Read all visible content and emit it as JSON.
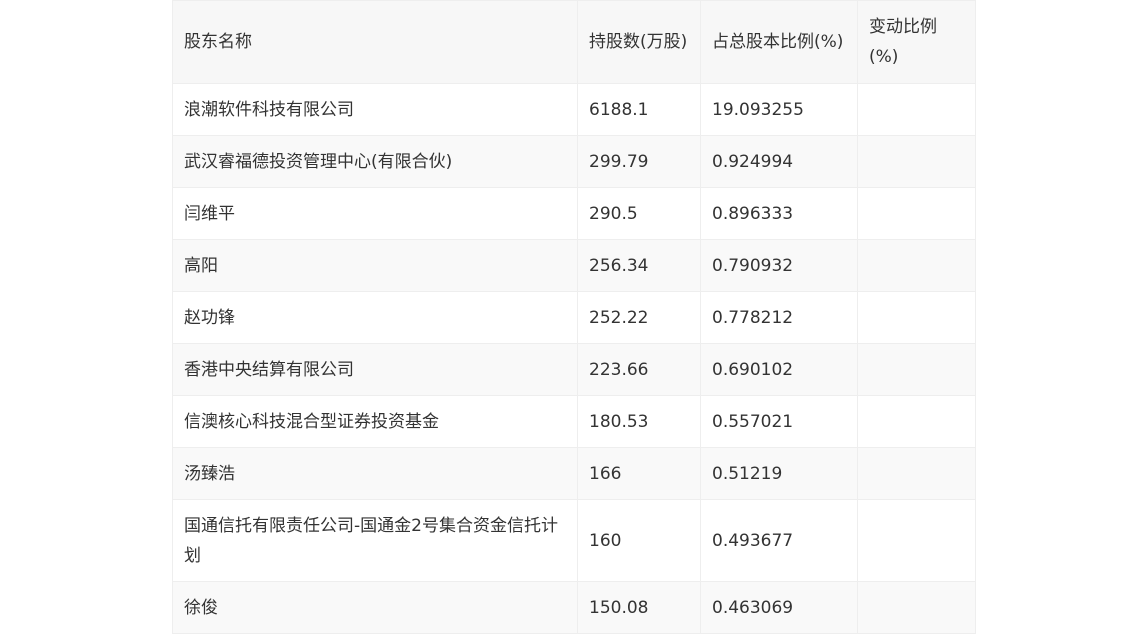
{
  "table": {
    "headers": [
      "股东名称",
      "持股数(万股)",
      "占总股本比例(%)",
      "变动比例(%)"
    ],
    "rows": [
      [
        "浪潮软件科技有限公司",
        "6188.1",
        "19.093255",
        ""
      ],
      [
        "武汉睿福德投资管理中心(有限合伙)",
        "299.79",
        "0.924994",
        ""
      ],
      [
        "闫维平",
        "290.5",
        "0.896333",
        ""
      ],
      [
        "高阳",
        "256.34",
        "0.790932",
        ""
      ],
      [
        "赵功锋",
        "252.22",
        "0.778212",
        ""
      ],
      [
        "香港中央结算有限公司",
        "223.66",
        "0.690102",
        ""
      ],
      [
        "信澳核心科技混合型证券投资基金",
        "180.53",
        "0.557021",
        ""
      ],
      [
        "汤臻浩",
        "166",
        "0.51219",
        ""
      ],
      [
        "国通信托有限责任公司-国通金2号集合资金信托计划",
        "160",
        "0.493677",
        ""
      ],
      [
        "徐俊",
        "150.08",
        "0.463069",
        ""
      ]
    ]
  }
}
